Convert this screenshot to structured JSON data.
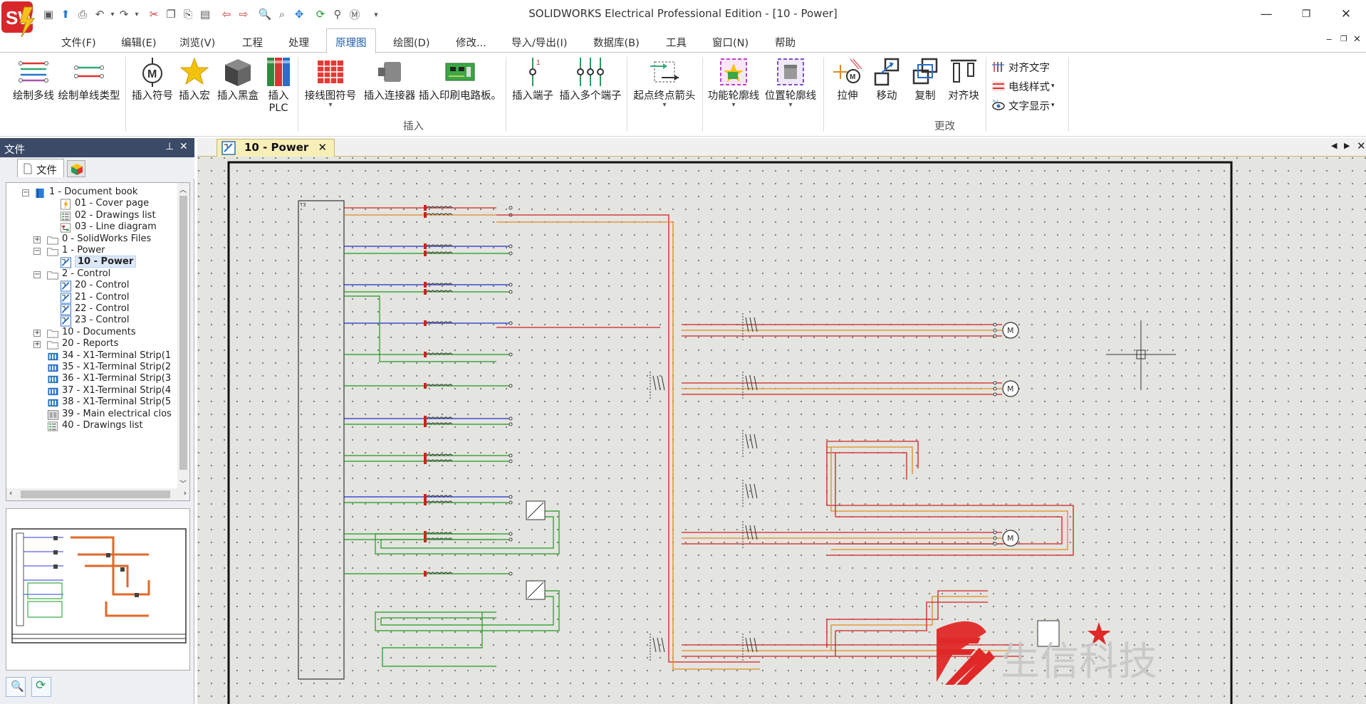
{
  "app": {
    "title": "SOLIDWORKS Electrical Professional Edition - [10 - Power]"
  },
  "menu": {
    "items": [
      "文件(F)",
      "编辑(E)",
      "浏览(V)",
      "工程",
      "处理",
      "原理图",
      "绘图(D)",
      "修改...",
      "导入/导出(I)",
      "数据库(B)",
      "工具",
      "窗口(N)",
      "帮助"
    ],
    "active_index": 5
  },
  "ribbon": {
    "buttons": [
      {
        "label": "绘制多线",
        "icon": "draw-multiwire-icon"
      },
      {
        "label": "绘制单线类型",
        "icon": "draw-single-wire-icon"
      },
      {
        "label": "插入符号",
        "icon": "insert-symbol-icon"
      },
      {
        "label": "插入宏",
        "icon": "insert-macro-star-icon"
      },
      {
        "label": "插入黑盒",
        "icon": "black-box-icon"
      },
      {
        "label": "插入",
        "label2": "PLC",
        "icon": "plc-icon"
      },
      {
        "label": "接线图符号",
        "icon": "wiring-symbol-icon"
      },
      {
        "label": "插入连接器",
        "icon": "connector-icon"
      },
      {
        "label": "插入印刷电路板。",
        "icon": "pcb-icon"
      },
      {
        "label": "插入端子",
        "icon": "terminal-icon"
      },
      {
        "label": "插入多个端子",
        "icon": "multi-terminal-icon"
      },
      {
        "label": "起点终点箭头",
        "icon": "origin-destination-arrow-icon"
      },
      {
        "label": "功能轮廓线",
        "icon": "function-outline-icon"
      },
      {
        "label": "位置轮廓线",
        "icon": "location-outline-icon"
      },
      {
        "label": "拉伸",
        "icon": "stretch-icon"
      },
      {
        "label": "移动",
        "icon": "move-icon"
      },
      {
        "label": "复制",
        "icon": "copy-icon"
      },
      {
        "label": "对齐块",
        "icon": "align-blocks-icon"
      }
    ],
    "small_buttons": [
      {
        "label": "对齐文字",
        "icon": "align-text-icon"
      },
      {
        "label": "电线样式",
        "icon": "wire-style-icon"
      },
      {
        "label": "文字显示",
        "icon": "text-display-icon"
      }
    ],
    "groups": [
      "插入",
      "更改"
    ]
  },
  "panel": {
    "title": "文件",
    "tab_files": "文件",
    "tree": [
      {
        "label": "1 - Document book",
        "level": 0,
        "expander": "−",
        "icon": "book-icon"
      },
      {
        "label": "01 - Cover page",
        "level": 2,
        "icon": "cover-page-icon"
      },
      {
        "label": "02 - Drawings list",
        "level": 2,
        "icon": "list-icon"
      },
      {
        "label": "03 - Line diagram",
        "level": 2,
        "icon": "line-diagram-icon"
      },
      {
        "label": "0 - SolidWorks Files",
        "level": 1,
        "expander": "+",
        "icon": "folder-icon"
      },
      {
        "label": "1 - Power",
        "level": 1,
        "expander": "−",
        "icon": "folder-icon"
      },
      {
        "label": "10 - Power",
        "level": 2,
        "icon": "scheme-icon",
        "selected": true
      },
      {
        "label": "2 - Control",
        "level": 1,
        "expander": "−",
        "icon": "folder-icon"
      },
      {
        "label": "20 - Control",
        "level": 2,
        "icon": "scheme-icon"
      },
      {
        "label": "21 - Control",
        "level": 2,
        "icon": "scheme-icon"
      },
      {
        "label": "22 - Control",
        "level": 2,
        "icon": "scheme-icon"
      },
      {
        "label": "23 - Control",
        "level": 2,
        "icon": "scheme-icon"
      },
      {
        "label": "10 - Documents",
        "level": 1,
        "expander": "+",
        "icon": "folder-icon"
      },
      {
        "label": "20 - Reports",
        "level": 1,
        "expander": "+",
        "icon": "folder-icon"
      },
      {
        "label": "34 - X1-Terminal Strip(1",
        "level": 1,
        "icon": "terminal-strip-icon"
      },
      {
        "label": "35 - X1-Terminal Strip(2",
        "level": 1,
        "icon": "terminal-strip-icon"
      },
      {
        "label": "36 - X1-Terminal Strip(3",
        "level": 1,
        "icon": "terminal-strip-icon"
      },
      {
        "label": "37 - X1-Terminal Strip(4",
        "level": 1,
        "icon": "terminal-strip-icon"
      },
      {
        "label": "38 - X1-Terminal Strip(5",
        "level": 1,
        "icon": "terminal-strip-icon"
      },
      {
        "label": "39 - Main electrical clos",
        "level": 1,
        "icon": "cabinet-icon"
      },
      {
        "label": "40 - Drawings list",
        "level": 1,
        "icon": "list-icon"
      }
    ]
  },
  "document": {
    "tab_label": "10 - Power",
    "watermark": "生信科技"
  },
  "colors": {
    "panel_header": "#3a4a67",
    "doc_tab": "#f8efb8",
    "wire_red": "#d02020",
    "wire_orange": "#e08a20",
    "wire_blue": "#1d2fd0",
    "wire_green": "#1e9a1e",
    "accent_blue": "#1f5fa8"
  }
}
